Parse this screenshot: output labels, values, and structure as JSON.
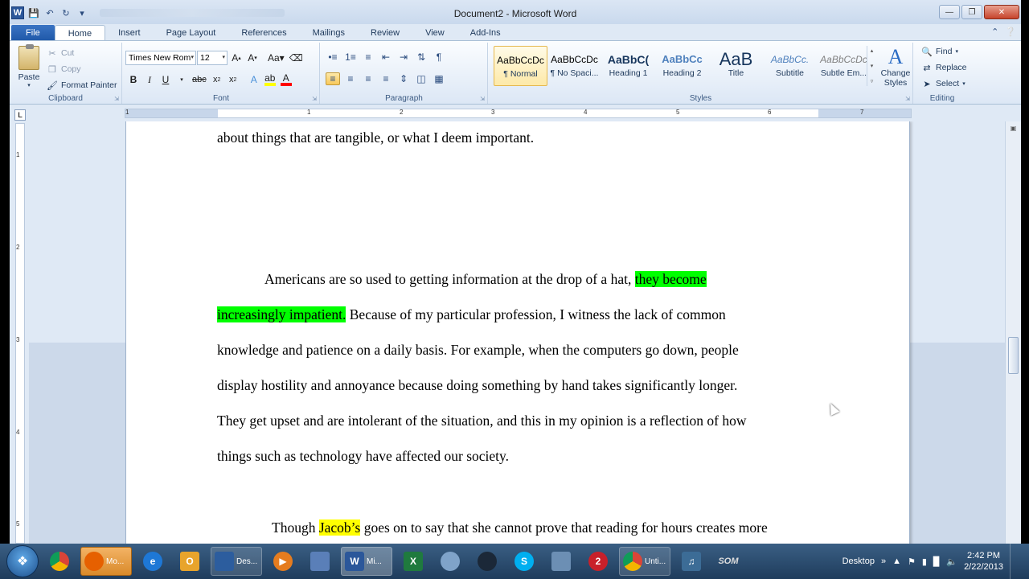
{
  "window": {
    "title": "Document2  -  Microsoft Word"
  },
  "tabs": [
    "File",
    "Home",
    "Insert",
    "Page Layout",
    "References",
    "Mailings",
    "Review",
    "View",
    "Add-Ins"
  ],
  "clipboard": {
    "paste": "Paste",
    "cut": "Cut",
    "copy": "Copy",
    "format_painter": "Format Painter",
    "label": "Clipboard"
  },
  "font": {
    "name": "Times New Rom",
    "size": "12",
    "label": "Font"
  },
  "paragraph": {
    "label": "Paragraph"
  },
  "styles": {
    "label": "Styles",
    "items": [
      {
        "sample": "AaBbCcDc",
        "name": "¶ Normal"
      },
      {
        "sample": "AaBbCcDc",
        "name": "¶ No Spaci..."
      },
      {
        "sample": "AaBbC(",
        "name": "Heading 1"
      },
      {
        "sample": "AaBbCc",
        "name": "Heading 2"
      },
      {
        "sample": "AaB",
        "name": "Title"
      },
      {
        "sample": "AaBbCc.",
        "name": "Subtitle"
      },
      {
        "sample": "AaBbCcDc",
        "name": "Subtle Em..."
      }
    ],
    "change_styles": "Change Styles"
  },
  "editing": {
    "find": "Find",
    "replace": "Replace",
    "select": "Select",
    "label": "Editing"
  },
  "document": {
    "line1": "about things that are tangible, or what I deem important.",
    "p2_l1_pre": "Americans are so used to getting information at the drop of a hat, ",
    "p2_l1_hl": "they become",
    "p2_l2_hl": "increasingly impatient.",
    "p2_l2_post": " Because of my particular profession, I witness the lack of common",
    "p2_l3": "knowledge and patience on a daily basis. For example, when the computers go down, people",
    "p2_l4": "display hostility and annoyance because doing something by hand takes significantly longer.",
    "p2_l5": "They get upset and are intolerant of the situation, and this in my opinion is a reflection of how",
    "p2_l6": "things such as technology have affected our society.",
    "p3_l1_pre": "Though ",
    "p3_l1_hl": "Jacob’s",
    "p3_l1_post": " goes on to say that she cannot prove that reading for hours creates more"
  },
  "taskbar": {
    "items": [
      "Mo...",
      "Des...",
      "Mi...",
      "Unti..."
    ],
    "desktop": "Desktop",
    "time": "2:42 PM",
    "date": "2/22/2013"
  },
  "colors": {
    "highlight_green": "#00ff00",
    "highlight_yellow": "#ffff00",
    "file_tab": "#2b5fb0"
  }
}
